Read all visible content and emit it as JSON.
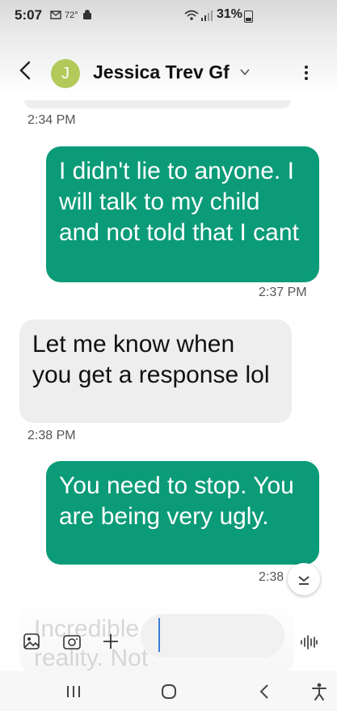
{
  "status_bar": {
    "time": "5:07",
    "temperature": "72°",
    "battery_percent": "31%"
  },
  "header": {
    "avatar_letter": "J",
    "contact_name": "Jessica Trev Gf"
  },
  "messages": [
    {
      "direction": "outgoing",
      "text": "I didn't lie to anyone. I will talk to my child and not told that I cant",
      "time": "2:37 PM"
    },
    {
      "direction": "incoming",
      "text": "Let me know when you get a response lol",
      "time": "2:38 PM"
    },
    {
      "direction": "outgoing",
      "text": "You need to stop. You are being very ugly.",
      "time": "2:38"
    }
  ],
  "previous_time": "2:34 PM",
  "ghost_preview": "Incredible will twist reality. Not",
  "colors": {
    "outgoing_bubble": "#0b9b78",
    "incoming_bubble": "#eeeeee",
    "avatar": "#b3c95a",
    "caret": "#3a7bd5"
  },
  "icons": {
    "gallery": "image-icon",
    "camera": "camera-icon",
    "add": "plus-icon",
    "emoji": "emoji-icon",
    "voice": "voice-waveform-icon",
    "scroll_down": "chevron-down-icon",
    "nav_recent": "recent-apps-icon",
    "nav_home": "home-icon",
    "nav_back": "back-icon",
    "nav_accessibility": "accessibility-icon"
  }
}
